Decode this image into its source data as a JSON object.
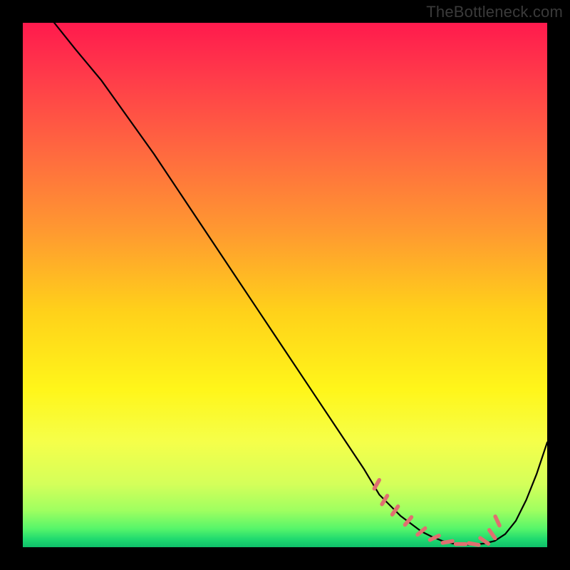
{
  "watermark": "TheBottleneck.com",
  "chart_data": {
    "type": "line",
    "title": "",
    "xlabel": "",
    "ylabel": "",
    "xlim": [
      0,
      100
    ],
    "ylim": [
      0,
      100
    ],
    "grid": false,
    "legend": false,
    "series": [
      {
        "name": "bottleneck-curve",
        "x": [
          6,
          10,
          15,
          20,
          25,
          30,
          35,
          40,
          45,
          50,
          55,
          60,
          65,
          68,
          70,
          72,
          74,
          76,
          78,
          80,
          82,
          84,
          86,
          88,
          90,
          92,
          94,
          96,
          98,
          100
        ],
        "y": [
          100,
          95,
          89,
          82,
          75,
          67.5,
          60,
          52.5,
          45,
          37.5,
          30,
          22.5,
          15,
          10,
          8,
          6,
          4.5,
          3,
          2,
          1.2,
          0.7,
          0.5,
          0.5,
          0.7,
          1.2,
          2.5,
          5,
          9,
          14,
          20
        ],
        "color": "#000000"
      }
    ],
    "highlight_band": {
      "name": "optimal-range-markers",
      "x": [
        67.5,
        69,
        71,
        73.5,
        76,
        78.5,
        81,
        83.5,
        86,
        88,
        89.5,
        90.5
      ],
      "y": [
        12,
        9,
        7,
        5,
        3,
        1.8,
        1,
        0.6,
        0.6,
        1.2,
        2.5,
        5
      ],
      "angle": [
        60,
        58,
        55,
        50,
        40,
        25,
        10,
        0,
        -10,
        -35,
        -55,
        -65
      ],
      "color": "#e07070"
    },
    "background_gradient": {
      "stops": [
        {
          "offset": 0.0,
          "color": "#ff1a4d"
        },
        {
          "offset": 0.1,
          "color": "#ff3a4a"
        },
        {
          "offset": 0.25,
          "color": "#ff6a3f"
        },
        {
          "offset": 0.4,
          "color": "#ff9a30"
        },
        {
          "offset": 0.55,
          "color": "#ffd11a"
        },
        {
          "offset": 0.7,
          "color": "#fff61a"
        },
        {
          "offset": 0.8,
          "color": "#f5ff4a"
        },
        {
          "offset": 0.88,
          "color": "#d4ff5a"
        },
        {
          "offset": 0.93,
          "color": "#9fff60"
        },
        {
          "offset": 0.965,
          "color": "#55f56a"
        },
        {
          "offset": 0.985,
          "color": "#1fd96f"
        },
        {
          "offset": 1.0,
          "color": "#0fbf6a"
        }
      ]
    }
  }
}
